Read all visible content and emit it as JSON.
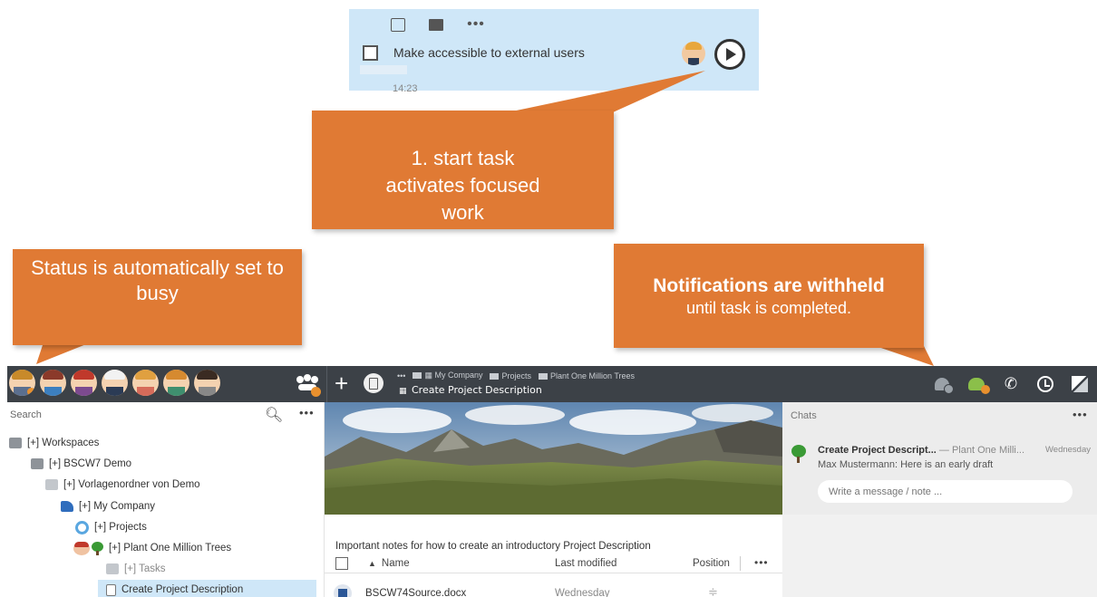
{
  "task_card": {
    "label": "Make accessible to external users",
    "time": "14:23",
    "tools": {
      "timer": "timer-icon",
      "note": "note-icon",
      "more": "•••"
    }
  },
  "callouts": {
    "start_task": "1. start task activates focused work",
    "status": "Status is automatically set to busy",
    "notifications_bold": "Notifications are withheld",
    "notifications_sub": "until task is completed."
  },
  "app_bar": {
    "breadcrumb_more": "•••",
    "breadcrumbs": [
      "My Company",
      "Projects",
      "Plant One Million Trees"
    ],
    "current_title": "Create Project Description",
    "plus": "+"
  },
  "left_panel": {
    "search_label": "Search",
    "more": "•••",
    "tree": [
      {
        "label": "[+] Workspaces"
      },
      {
        "label": "[+] BSCW7 Demo"
      },
      {
        "label": "[+] Vorlagenordner von Demo"
      },
      {
        "label": "[+] My Company"
      },
      {
        "label": "[+] Projects"
      },
      {
        "label": "[+] Plant One Million Trees"
      },
      {
        "label": "[+] Tasks"
      },
      {
        "label": "Create Project Description"
      }
    ]
  },
  "content": {
    "notes": "Important notes for how to create an introductory Project Description",
    "columns": {
      "name": "Name",
      "modified": "Last modified",
      "position": "Position",
      "more": "•••"
    },
    "rows": [
      {
        "name": "BSCW74Source.docx",
        "modified": "Wednesday",
        "position": "≑"
      }
    ]
  },
  "chat_panel": {
    "label": "Chats",
    "more": "•••",
    "chat_title": "Create Project Descript...",
    "chat_workspace": "— Plant One Milli...",
    "chat_day": "Wednesday",
    "chat_message": "Max Mustermann: Here is an early draft",
    "input_placeholder": "Write a message / note ..."
  },
  "colors": {
    "callout": "#e07a34",
    "selection": "#cfe7f8",
    "app_bar": "#3c4147",
    "busy_status": "#e8902e"
  }
}
